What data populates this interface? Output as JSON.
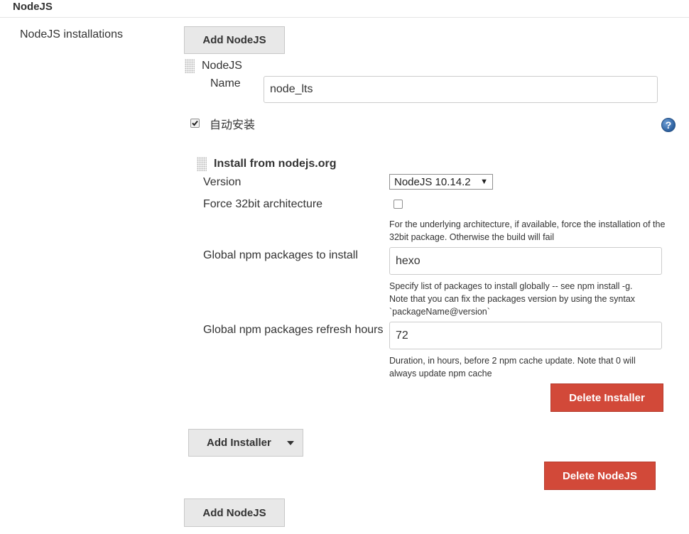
{
  "section": {
    "title": "NodeJS"
  },
  "installations": {
    "label": "NodeJS installations",
    "add_button_top": "Add NodeJS",
    "add_button_bottom": "Add NodeJS"
  },
  "nodejs": {
    "header": "NodeJS",
    "name_label": "Name",
    "name_value": "node_lts",
    "auto_install_label": "自动安装",
    "auto_install_checked": true,
    "help_icon": "question-circle-icon",
    "delete_button": "Delete NodeJS"
  },
  "installer": {
    "header": "Install from nodejs.org",
    "version_label": "Version",
    "version_value": "NodeJS 10.14.2",
    "force32_label": "Force 32bit architecture",
    "force32_checked": false,
    "force32_help": "For the underlying architecture, if available, force the installation of the 32bit package. Otherwise the build will fail",
    "npm_label": "Global npm packages to install",
    "npm_value": "hexo",
    "npm_help_1": "Specify list of packages to install globally -- see npm install -g.",
    "npm_help_2": "Note that you can fix the packages version by using the syntax",
    "npm_help_3": "`packageName@version`",
    "refresh_label": "Global npm packages refresh hours",
    "refresh_value": "72",
    "refresh_help": "Duration, in hours, before 2 npm cache update. Note that 0 will always update npm cache",
    "delete_button": "Delete Installer",
    "add_installer_button": "Add Installer"
  },
  "colors": {
    "danger": "#d24939",
    "button_gray": "#e8e8e8",
    "help_blue": "#2b5f9e"
  }
}
